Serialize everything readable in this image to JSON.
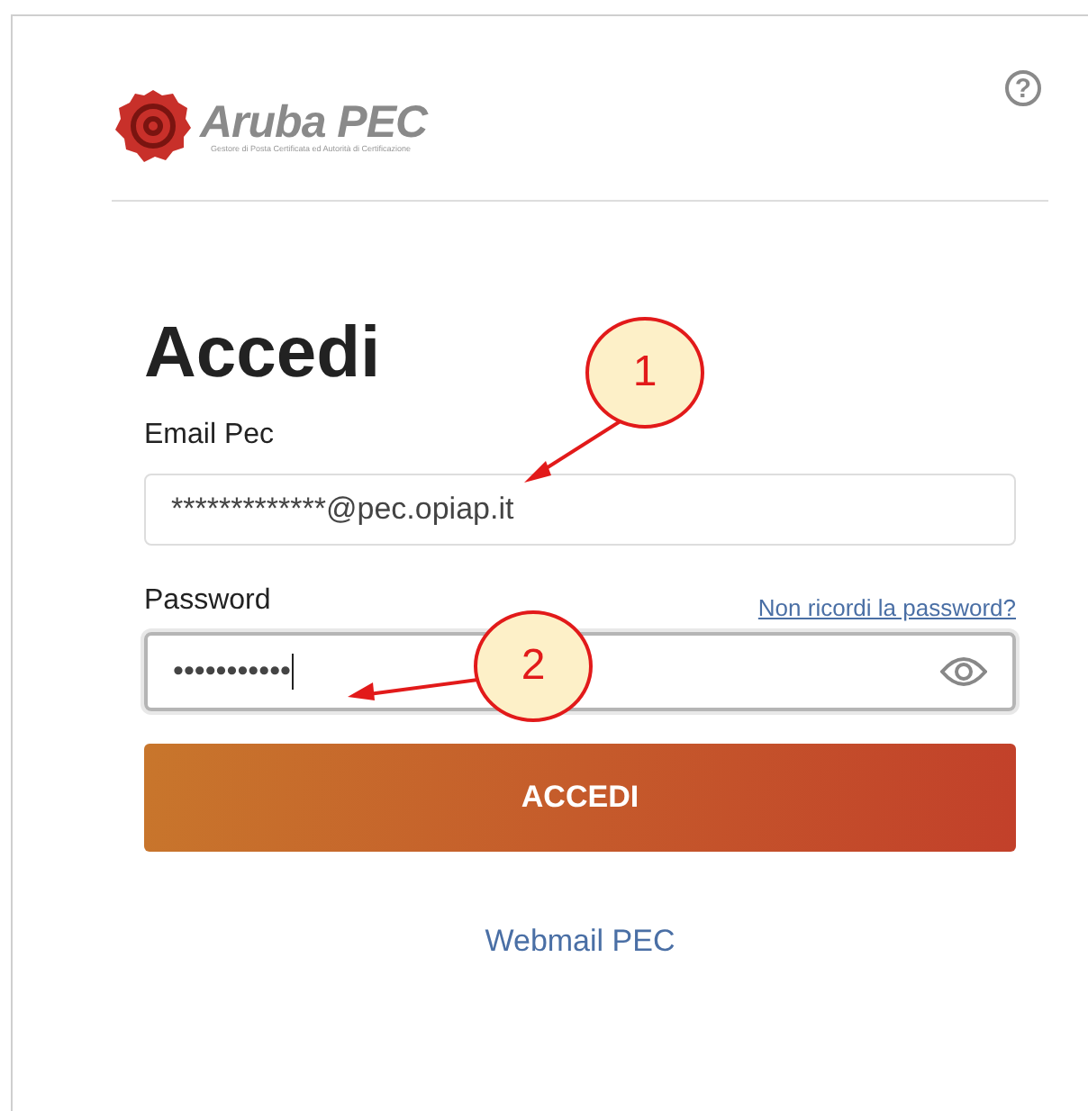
{
  "logo": {
    "name": "Aruba PEC",
    "tagline": "Gestore di Posta Certificata ed Autorità di Certificazione"
  },
  "help": {
    "label": "?"
  },
  "heading": "Accedi",
  "email": {
    "label": "Email Pec",
    "value": "*************@pec.opiap.it",
    "focused": false
  },
  "password": {
    "label": "Password",
    "value": "•••••••••••",
    "focused": true,
    "forgot_link": "Non ricordi la password?"
  },
  "submit": "ACCEDI",
  "webmail_link": "Webmail PEC",
  "annotations": [
    {
      "number": "1"
    },
    {
      "number": "2"
    }
  ]
}
